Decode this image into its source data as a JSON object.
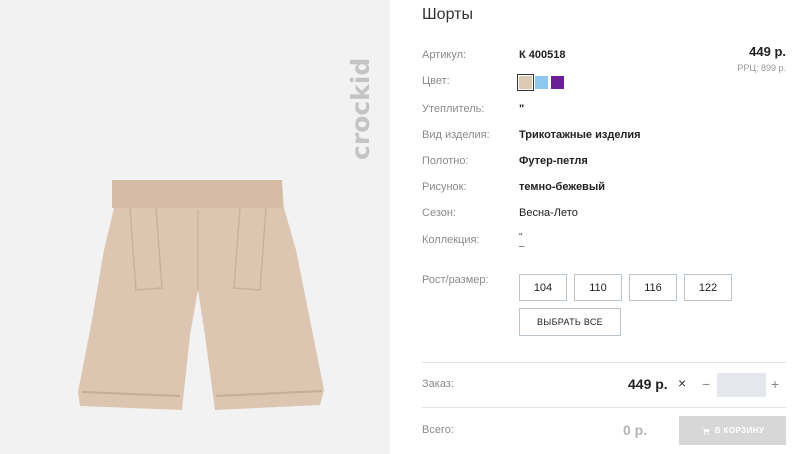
{
  "brand": {
    "logo_text": "crockid"
  },
  "product": {
    "title": "Шорты",
    "price": "449 р.",
    "rrp": "РРЦ: 899 р.",
    "attributes": [
      {
        "label": "Артикул:",
        "value": "К 400518"
      },
      {
        "label": "Цвет:",
        "value": ""
      },
      {
        "label": "Утеплитель:",
        "value": "\""
      },
      {
        "label": "Вид изделия:",
        "value": "Трикотажные изделия"
      },
      {
        "label": "Полотно:",
        "value": "Футер-петля"
      },
      {
        "label": "Рисунок:",
        "value": "темно-бежевый"
      },
      {
        "label": "Сезон:",
        "value": "Весна-Лето"
      },
      {
        "label": "Коллекция:",
        "value": "\""
      },
      {
        "label": "Рост/размер:",
        "value": ""
      }
    ],
    "collection_extra": "–",
    "colors": [
      "#dccab5",
      "#8fc6ee",
      "#6a1f96"
    ],
    "sizes": [
      "104",
      "110",
      "116",
      "122"
    ],
    "select_all_label": "ВЫБРАТЬ ВСЕ"
  },
  "order": {
    "label": "Заказ:",
    "price": "449 р.",
    "times": "×",
    "minus": "−",
    "plus": "+",
    "quantity": ""
  },
  "total": {
    "label": "Всего:",
    "value": "0 р.",
    "cart_label": "В КОРЗИНУ"
  }
}
